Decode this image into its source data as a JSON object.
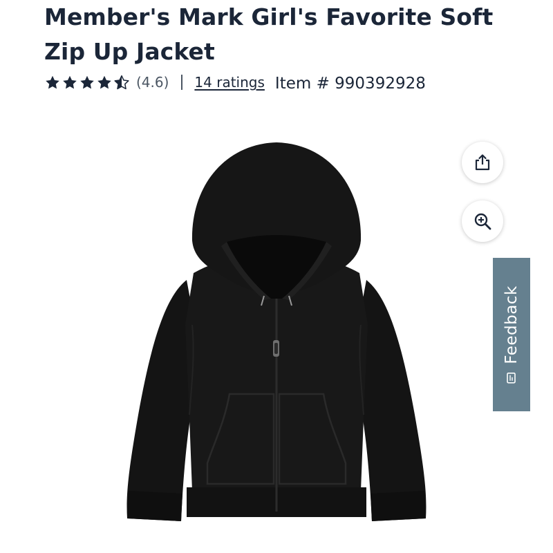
{
  "product": {
    "title": "Member's Mark Girl's Favorite Soft Zip Up Jacket",
    "rating_value": 4.6,
    "rating_text": "(4.6)",
    "ratings_count_text": "14 ratings",
    "item_number_text": "Item # 990392928",
    "image_icon": "black-zip-hoodie-jacket"
  },
  "actions": {
    "share_icon": "share-icon",
    "zoom_icon": "zoom-in-icon"
  },
  "feedback": {
    "label": "Feedback",
    "icon": "feedback-icon",
    "color": "#65808f"
  },
  "colors": {
    "text": "#1b2638",
    "muted": "#4b5663",
    "star": "#1b2638"
  }
}
